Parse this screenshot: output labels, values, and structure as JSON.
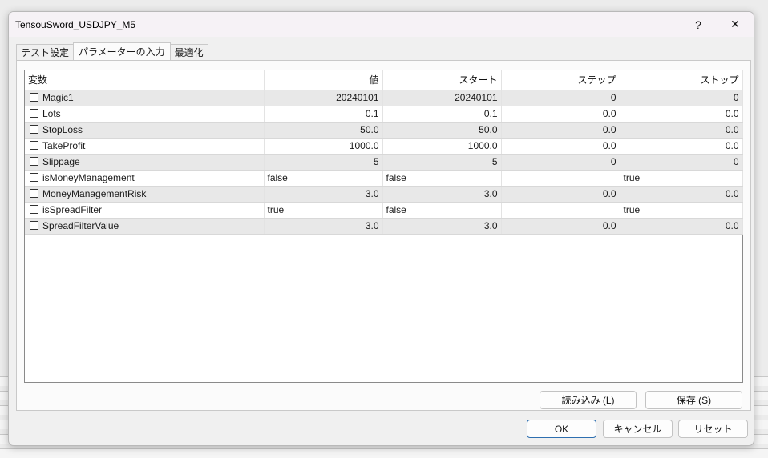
{
  "window": {
    "title": "TensouSword_USDJPY_M5",
    "help": "?",
    "close": "✕"
  },
  "tabs": [
    "テスト設定",
    "パラメーターの入力",
    "最適化"
  ],
  "grid": {
    "headers": [
      "変数",
      "値",
      "スタート",
      "ステップ",
      "ストップ"
    ],
    "rows": [
      {
        "name": "Magic1",
        "value": "20240101",
        "start": "20240101",
        "step": "0",
        "stop": "0"
      },
      {
        "name": "Lots",
        "value": "0.1",
        "start": "0.1",
        "step": "0.0",
        "stop": "0.0"
      },
      {
        "name": "StopLoss",
        "value": "50.0",
        "start": "50.0",
        "step": "0.0",
        "stop": "0.0"
      },
      {
        "name": "TakeProfit",
        "value": "1000.0",
        "start": "1000.0",
        "step": "0.0",
        "stop": "0.0"
      },
      {
        "name": "Slippage",
        "value": "5",
        "start": "5",
        "step": "0",
        "stop": "0"
      },
      {
        "name": "isMoneyManagement",
        "value": "false",
        "start": "false",
        "step": "",
        "stop": "true"
      },
      {
        "name": "MoneyManagementRisk",
        "value": "3.0",
        "start": "3.0",
        "step": "0.0",
        "stop": "0.0"
      },
      {
        "name": "isSpreadFilter",
        "value": "true",
        "start": "false",
        "step": "",
        "stop": "true"
      },
      {
        "name": "SpreadFilterValue",
        "value": "3.0",
        "start": "3.0",
        "step": "0.0",
        "stop": "0.0"
      }
    ]
  },
  "buttons": {
    "load": "読み込み (L)",
    "save": "保存 (S)",
    "ok": "OK",
    "cancel": "キャンセル",
    "reset": "リセット"
  }
}
